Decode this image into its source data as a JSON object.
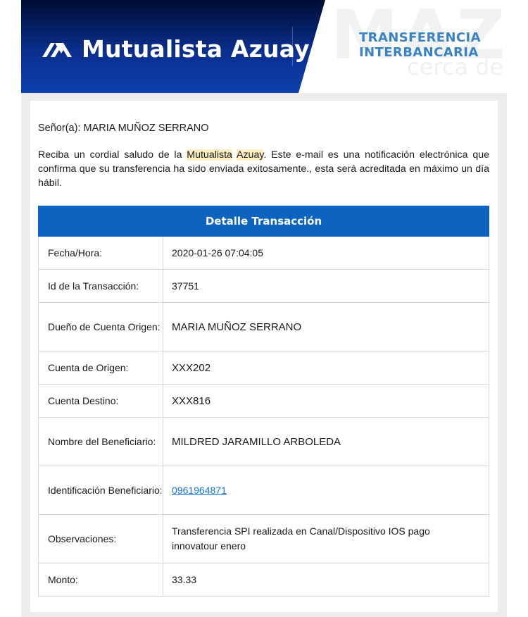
{
  "header": {
    "brand": "Mutualista Azuay",
    "title_line1": "TRANSFERENCIA",
    "title_line2": "INTERBANCARIA",
    "watermark": "MAZ",
    "watermark_sub": "cerca de ti",
    "brand_color": "#0a2f8f",
    "accent_color": "#3b82c4"
  },
  "greeting": {
    "prefix": "Señor(a): ",
    "name": "MARIA MUÑOZ SERRANO"
  },
  "intro": {
    "part1": "Reciba un cordial saludo de la ",
    "highlight1": "Mutualista",
    "space": " ",
    "highlight2": "Azuay",
    "part2": ". Este e-mail es una notificación electrónica que confirma que su transferencia ha sido enviada exitosamente., esta será acreditada en máximo un día hábil."
  },
  "table": {
    "header": "Detalle Transacción",
    "header_color": "#0d63c0",
    "rows": [
      {
        "label": "Fecha/Hora:",
        "value": "2020-01-26 07:04:05"
      },
      {
        "label": "Id de la Transacción:",
        "value": "37751"
      },
      {
        "label": "Dueño de Cuenta Origen:",
        "value": "MARIA MUÑOZ SERRANO"
      },
      {
        "label": "Cuenta de Origen:",
        "value": "XXX202"
      },
      {
        "label": "Cuenta Destino:",
        "value": "XXX816"
      },
      {
        "label": "Nombre del Beneficiario:",
        "value": "MILDRED JARAMILLO ARBOLEDA"
      },
      {
        "label": "Identificación Beneficiario:",
        "value": "0961964871"
      },
      {
        "label": "Observaciones:",
        "value": "Transferencia SPI realizada en Canal/Dispositivo IOS pago innovatour enero"
      },
      {
        "label": "Monto:",
        "value": "33.33"
      }
    ]
  }
}
